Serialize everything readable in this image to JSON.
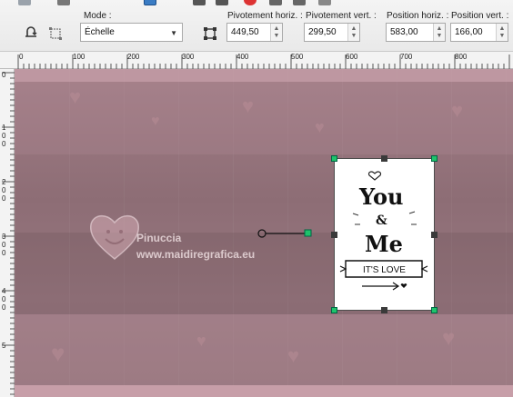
{
  "toolbar": {
    "mode_label": "Mode :",
    "mode_value": "Échelle",
    "pivot_x_label": "Pivotement horiz. :",
    "pivot_x_value": "449,50",
    "pivot_y_label": "Pivotement vert. :",
    "pivot_y_value": "299,50",
    "pos_x_label": "Position horiz. :",
    "pos_x_value": "583,00",
    "pos_y_label": "Position vert. :",
    "pos_y_value": "166,00"
  },
  "ruler": {
    "h_labels": [
      "0",
      "100",
      "200",
      "300",
      "400",
      "500",
      "600",
      "700",
      "800"
    ],
    "v_labels": [
      "0",
      "1 0 0",
      "2 0 0",
      "3 0 0",
      "4 0 0",
      "5"
    ]
  },
  "watermark": {
    "name": "Pinuccia",
    "url": "www.maidiregrafica.eu"
  },
  "card": {
    "line1": "You",
    "amp": "&",
    "line2": "Me",
    "banner": "IT'S LOVE"
  },
  "colors": {
    "canvas": "#987780",
    "selection_handle": "#1ec36b",
    "accent_blue": "#3a7cc4"
  }
}
